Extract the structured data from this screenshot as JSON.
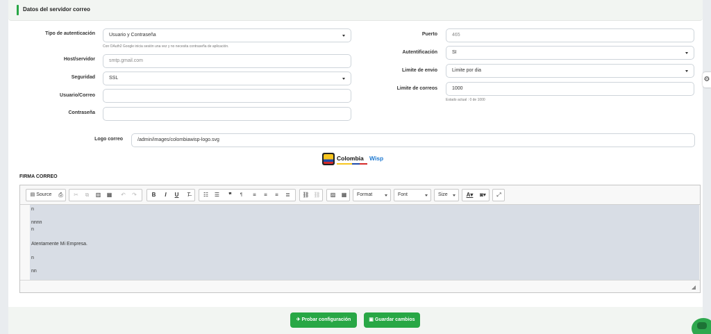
{
  "section": {
    "title": "Datos del servidor correo"
  },
  "left_form": {
    "auth_type": {
      "label": "Tipo de autenticación",
      "value": "Usuario y Contraseña",
      "help": "Con OAuth2 Google inicia sesión una vez y no necesita contraseña de aplicación."
    },
    "host": {
      "label": "Host/servidor",
      "placeholder": "smtp.gmail.com"
    },
    "security": {
      "label": "Seguridad",
      "value": "SSL"
    },
    "user": {
      "label": "Usuario/Correo",
      "value": ""
    },
    "password": {
      "label": "Contraseña",
      "value": ""
    }
  },
  "right_form": {
    "port": {
      "label": "Puerto",
      "placeholder": "465"
    },
    "authentication": {
      "label": "Autentificación",
      "value": "SI"
    },
    "send_limit": {
      "label": "Limite de envio",
      "value": "Limite por dia"
    },
    "mail_limit": {
      "label": "Limite de correos",
      "value": "1000",
      "help": "Estado actual : 0 de 1000"
    }
  },
  "logo": {
    "label": "Logo correo",
    "value": "/admin/images/colombiawisp-logo.svg",
    "brand_part1": "Colombia",
    "brand_part2": "Wisp"
  },
  "firma": {
    "title": "FIRMA CORREO",
    "toolbar": {
      "source_label": "Source",
      "format_label": "Format",
      "font_label": "Font",
      "size_label": "Size"
    },
    "content_lines": [
      "n",
      "nnnn",
      "n",
      "Atentamente Mi Empresa.",
      "n",
      "nn"
    ]
  },
  "actions": {
    "test_label": "Probar configuración",
    "save_label": "Guardar cambios"
  },
  "colors": {
    "accent": "#28a745",
    "editor_bg": "#d8dde5",
    "header_bg": "#f2f5f2"
  },
  "icons": {
    "settings": "gear-icon",
    "chat": "chatbot-icon"
  }
}
